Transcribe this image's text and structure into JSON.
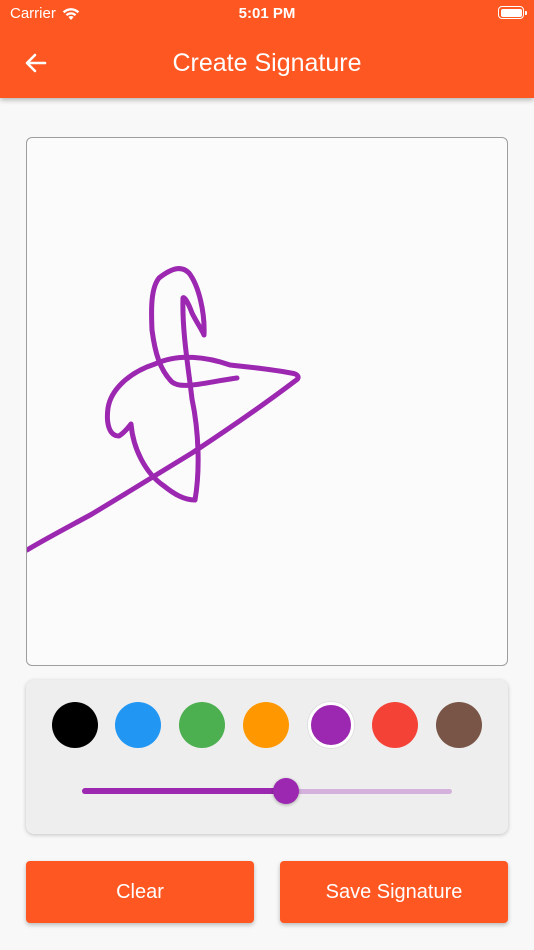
{
  "status_bar": {
    "carrier": "Carrier",
    "time": "5:01 PM",
    "icons": [
      "wifi-icon",
      "battery-icon"
    ]
  },
  "header": {
    "title": "Create Signature",
    "back_icon": "arrow-left-icon",
    "color": "#ff5722"
  },
  "signature_pad": {
    "stroke_color": "#9c27b0",
    "background": "#fbfbfb",
    "border_color": "#9e9e9e"
  },
  "palette": {
    "colors": [
      {
        "name": "black",
        "hex": "#000000"
      },
      {
        "name": "blue",
        "hex": "#2196f3"
      },
      {
        "name": "green",
        "hex": "#4caf50"
      },
      {
        "name": "orange",
        "hex": "#ff9800"
      },
      {
        "name": "purple",
        "hex": "#9c27b0"
      },
      {
        "name": "red",
        "hex": "#f44336"
      },
      {
        "name": "brown",
        "hex": "#795548"
      }
    ],
    "selected_index": 4,
    "stroke_width_fraction": 0.55
  },
  "actions": {
    "clear_label": "Clear",
    "save_label": "Save Signature"
  }
}
